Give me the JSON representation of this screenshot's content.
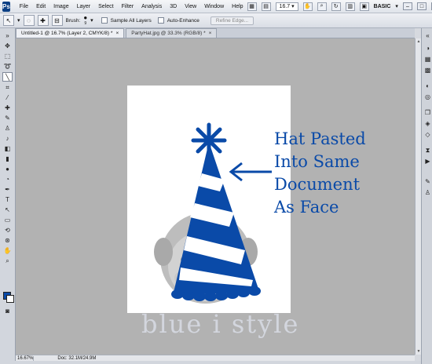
{
  "app": {
    "logo": "Ps",
    "menu": [
      "File",
      "Edit",
      "Image",
      "Layer",
      "Select",
      "Filter",
      "Analysis",
      "3D",
      "View",
      "Window",
      "Help"
    ],
    "zoom": "16.7",
    "workspace": "BASIC"
  },
  "options": {
    "brush_label": "Brush:",
    "brush_size": "9",
    "sample_all_layers": "Sample All Layers",
    "auto_enhance": "Auto-Enhance",
    "refine_edge": "Refine Edge..."
  },
  "tabs": [
    {
      "label": "Untitled-1 @ 16.7% (Layer 2, CMYK/8) *",
      "active": true
    },
    {
      "label": "PartyHat.jpg @ 33.3% (RGB/8) *",
      "active": false
    }
  ],
  "annotation": {
    "lines": [
      "Hat Pasted",
      "Into Same",
      "Document",
      "As Face"
    ],
    "color": "#0a4aa8"
  },
  "watermark": "blue i style",
  "status": {
    "zoom": "16.67%",
    "doc": "Doc: 32.1M/24.9M"
  },
  "colors": {
    "accent_blue": "#0a4aa8",
    "canvas_gray": "#b2b2b2"
  }
}
